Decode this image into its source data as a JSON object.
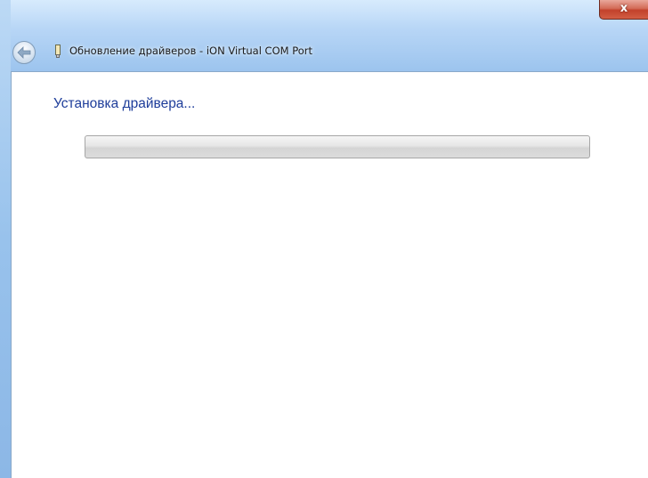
{
  "window": {
    "title": "Обновление драйверов - iON Virtual COM Port",
    "close_label": "x",
    "back_icon": "back-arrow-icon",
    "app_icon": "device-icon"
  },
  "main": {
    "heading": "Установка драйвера...",
    "progress": {
      "value_percent": 0,
      "state": "indeterminate"
    }
  },
  "colors": {
    "heading": "#1e3d9a",
    "titlebar": "#b8d6f6",
    "close_button": "#c2412b"
  }
}
